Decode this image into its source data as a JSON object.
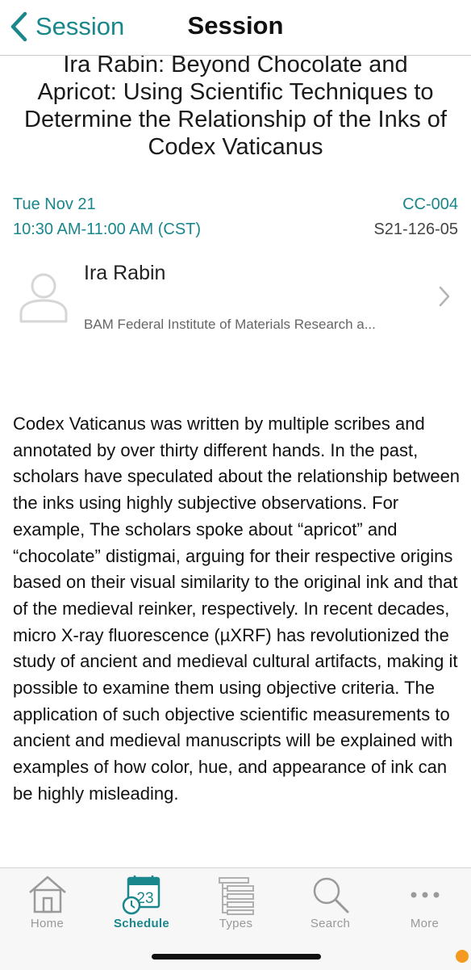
{
  "navbar": {
    "back_label": "Session",
    "title": "Session"
  },
  "session": {
    "title": "Ira Rabin: Beyond Chocolate and Apricot: Using Scientific Techniques to Determine the Relationship of the Inks of Codex Vaticanus",
    "date": "Tue Nov 21",
    "time": "10:30 AM-11:00 AM (CST)",
    "room": "CC-004",
    "code": "S21-126-05"
  },
  "speaker": {
    "name": "Ira Rabin",
    "organization": "BAM Federal Institute of Materials Research a..."
  },
  "description": "Codex Vaticanus was written by multiple scribes and annotated by over thirty different hands. In the past, scholars have speculated about the relationship between the inks using highly subjective observations. For example, The scholars spoke about “apricot” and “chocolate” distigmai, arguing for their respective origins based on their visual similarity to the original ink and that of the medieval reinker, respectively. In recent decades, micro X-ray fluorescence (µXRF) has revolutionized the study of ancient and medieval cultural artifacts, making it possible to examine them using objective criteria. The application of such objective scientific measurements to ancient and medieval manuscripts will be explained with examples of how color, hue, and appearance of ink can be highly misleading.",
  "tabs": [
    {
      "label": "Home",
      "icon": "home-icon"
    },
    {
      "label": "Schedule",
      "icon": "calendar-icon",
      "badge": "23",
      "active": true
    },
    {
      "label": "Types",
      "icon": "list-icon"
    },
    {
      "label": "Search",
      "icon": "search-icon"
    },
    {
      "label": "More",
      "icon": "more-icon"
    }
  ],
  "colors": {
    "accent": "#19878c",
    "notification_dot": "#f39a1f"
  }
}
